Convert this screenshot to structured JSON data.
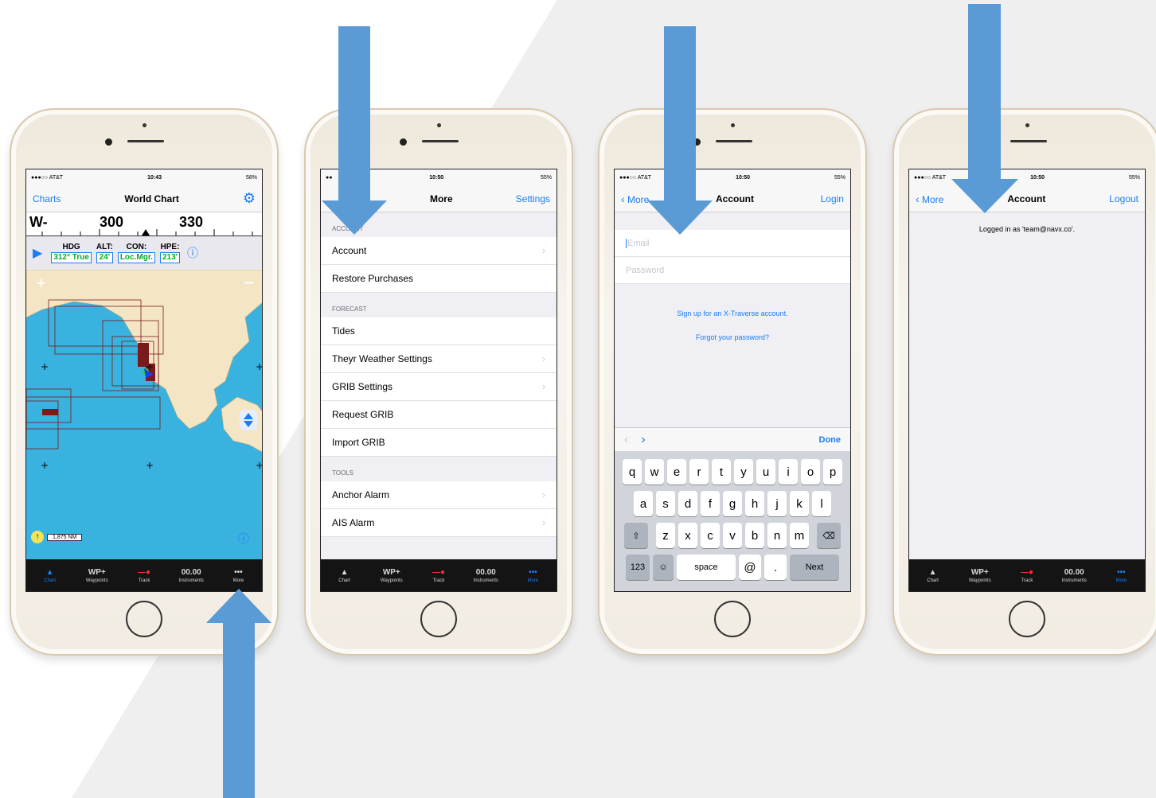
{
  "colors": {
    "accent": "#1a7cf5",
    "arrow": "#5b9bd5",
    "sea": "#39b2e0",
    "land": "#f4e6c4"
  },
  "phone1": {
    "status": {
      "carrier": "●●●○○ AT&T",
      "time": "10:43",
      "battery": "58%"
    },
    "nav": {
      "left": "Charts",
      "title": "World Chart",
      "right_icon": "gear-icon"
    },
    "ruler": {
      "prefix": "W-",
      "mark1": "300",
      "mark2": "330"
    },
    "info": [
      {
        "label": "HDG",
        "value": "312° True"
      },
      {
        "label": "ALT:",
        "value": "24'"
      },
      {
        "label": "CON:",
        "value": "Loc.Mgr."
      },
      {
        "label": "HPE:",
        "value": "213'"
      }
    ],
    "scale": "1,875 NM",
    "tabs": [
      {
        "glyph": "▲",
        "label": "Chart"
      },
      {
        "glyph": "WP+",
        "label": "Waypoints"
      },
      {
        "glyph": "—●",
        "label": "Track"
      },
      {
        "glyph": "00.00",
        "label": "Instruments"
      },
      {
        "glyph": "•••",
        "label": "More"
      }
    ]
  },
  "phone2": {
    "status": {
      "carrier": "●●",
      "time": "10:50",
      "battery": "55%"
    },
    "nav": {
      "title": "More",
      "right": "Settings"
    },
    "sections": [
      {
        "header": "ACCOUNT",
        "rows": [
          {
            "label": "Account",
            "chevron": true
          },
          {
            "label": "Restore Purchases",
            "chevron": false
          }
        ]
      },
      {
        "header": "FORECAST",
        "rows": [
          {
            "label": "Tides",
            "chevron": false
          },
          {
            "label": "Theyr Weather Settings",
            "chevron": true
          },
          {
            "label": "GRIB Settings",
            "chevron": true
          },
          {
            "label": "Request GRIB",
            "chevron": false
          },
          {
            "label": "Import GRIB",
            "chevron": false
          }
        ]
      },
      {
        "header": "TOOLS",
        "rows": [
          {
            "label": "Anchor Alarm",
            "chevron": true
          },
          {
            "label": "AIS Alarm",
            "chevron": true
          }
        ]
      }
    ],
    "tabs": [
      {
        "glyph": "▲",
        "label": "Chart"
      },
      {
        "glyph": "WP+",
        "label": "Waypoints"
      },
      {
        "glyph": "—●",
        "label": "Track"
      },
      {
        "glyph": "00.00",
        "label": "Instruments"
      },
      {
        "glyph": "•••",
        "label": "More"
      }
    ]
  },
  "phone3": {
    "status": {
      "carrier": "●●●○○ AT&T",
      "time": "10:50",
      "battery": "55%"
    },
    "nav": {
      "back": "More",
      "title": "Account",
      "right": "Login"
    },
    "email_placeholder": "Email",
    "password_placeholder": "Password",
    "signup": "Sign up for an X-Traverse account.",
    "forgot": "Forgot your password?",
    "toolbar_done": "Done",
    "keys_row1": [
      "q",
      "w",
      "e",
      "r",
      "t",
      "y",
      "u",
      "i",
      "o",
      "p"
    ],
    "keys_row2": [
      "a",
      "s",
      "d",
      "f",
      "g",
      "h",
      "j",
      "k",
      "l"
    ],
    "keys_row3": [
      "z",
      "x",
      "c",
      "v",
      "b",
      "n",
      "m"
    ],
    "key_123": "123",
    "key_space": "space",
    "key_at": "@",
    "key_dot": ".",
    "key_next": "Next"
  },
  "phone4": {
    "status": {
      "carrier": "●●●○○ AT&T",
      "time": "10:50",
      "battery": "55%"
    },
    "nav": {
      "back": "More",
      "title": "Account",
      "right": "Logout"
    },
    "message": "Logged in as 'team@navx.co'.",
    "tabs": [
      {
        "glyph": "▲",
        "label": "Chart"
      },
      {
        "glyph": "WP+",
        "label": "Waypoints"
      },
      {
        "glyph": "—●",
        "label": "Track"
      },
      {
        "glyph": "00.00",
        "label": "Instruments"
      },
      {
        "glyph": "•••",
        "label": "More"
      }
    ]
  }
}
